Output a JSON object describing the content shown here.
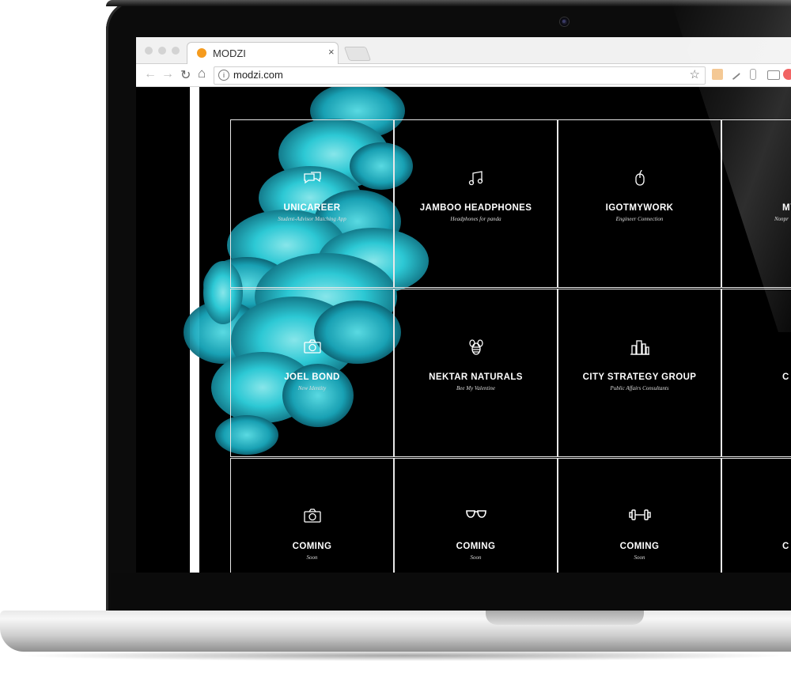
{
  "browser": {
    "tab_title": "MODZI",
    "tab_close": "×",
    "url": "modzi.com",
    "info": "i",
    "star": "☆",
    "back": "←",
    "forward": "→",
    "reload": "↻",
    "home": "⌂"
  },
  "colors": {
    "accent_ink": "#2fd3e0",
    "favicon": "#f59b1e",
    "page_background": "#000000"
  },
  "projects": [
    {
      "title": "UNICAREER",
      "subtitle": "Student-Advisor Matching App",
      "icon": "chat-bubbles-icon"
    },
    {
      "title": "JAMBOO HEADPHONES",
      "subtitle": "Headphones for panda",
      "icon": "music-note-icon"
    },
    {
      "title": "IGOTMYWORK",
      "subtitle": "Engineer Connection",
      "icon": "mouse-icon"
    },
    {
      "title": "MY",
      "subtitle": "Nonpr",
      "icon": ""
    },
    {
      "title": "JOEL BOND",
      "subtitle": "New Identity",
      "icon": "camera-icon"
    },
    {
      "title": "NEKTAR NATURALS",
      "subtitle": "Bee My Valentine",
      "icon": "bee-icon"
    },
    {
      "title": "CITY STRATEGY GROUP",
      "subtitle": "Public Affairs Consultants",
      "icon": "city-buildings-icon"
    },
    {
      "title": "C",
      "subtitle": "",
      "icon": ""
    },
    {
      "title": "COMING",
      "subtitle": "Soon",
      "icon": "camera-icon"
    },
    {
      "title": "COMING",
      "subtitle": "Soon",
      "icon": "glasses-icon"
    },
    {
      "title": "COMING",
      "subtitle": "Soon",
      "icon": "dumbbell-icon"
    },
    {
      "title": "C",
      "subtitle": "",
      "icon": ""
    }
  ]
}
